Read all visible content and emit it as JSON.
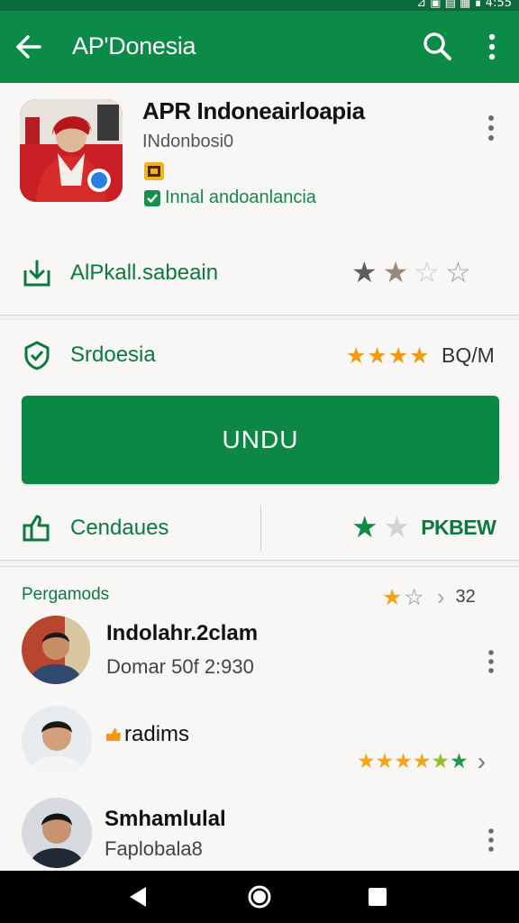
{
  "status_bar": {
    "icons": "⊿ ▣ ▤ ▦ ∎ 4:55"
  },
  "appbar": {
    "title": "AP'Donesia"
  },
  "app": {
    "name": "APR Indoneairloapia",
    "developer": "INdonbosi0",
    "tag": "Innal andoanlancia"
  },
  "card1": {
    "row_label": "AlPkall.sabeain",
    "rating_stars_filled": 2,
    "rating_stars_total": 4
  },
  "card2": {
    "security_label": "Srdoesia",
    "stars_filled": 4,
    "size": "BQ/M",
    "install_label": "UNDU",
    "left_action": "Cendaues",
    "right_action": "PKBEW"
  },
  "reviews": {
    "title": "Pergamods",
    "count": "32",
    "items": [
      {
        "name": "Indolahr.2clam",
        "sub": "Domar 50f 2:930"
      },
      {
        "name": "radims",
        "stars": 6
      },
      {
        "name": "Smhamlulal",
        "sub": "Faplobala8"
      }
    ]
  },
  "colors": {
    "primary": "#0c8a47",
    "accent_star": "#f29a11",
    "text_green": "#0b7a3f"
  }
}
